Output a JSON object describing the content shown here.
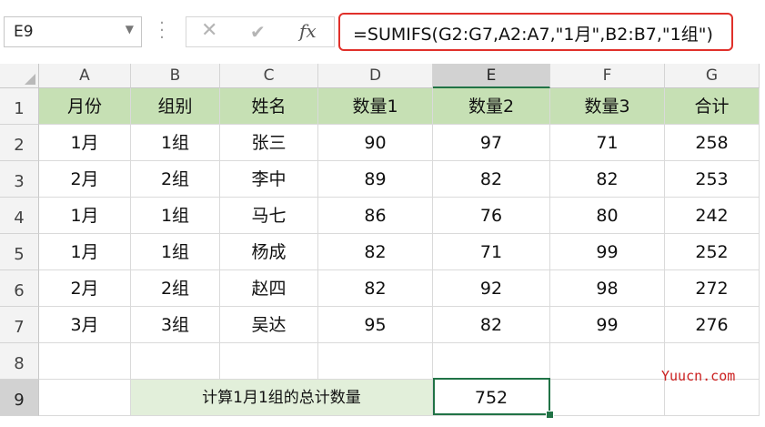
{
  "name_box": {
    "value": "E9"
  },
  "formula_bar": {
    "formula": "=SUMIFS(G2:G7,A2:A7,\"1月\",B2:B7,\"1组\")",
    "fx_label": "fx"
  },
  "columns": [
    "A",
    "B",
    "C",
    "D",
    "E",
    "F",
    "G"
  ],
  "rows": [
    "1",
    "2",
    "3",
    "4",
    "5",
    "6",
    "7",
    "8",
    "9"
  ],
  "active_column": "E",
  "active_row": "9",
  "table": {
    "headers": [
      "月份",
      "组别",
      "姓名",
      "数量1",
      "数量2",
      "数量3",
      "合计"
    ],
    "data": [
      [
        "1月",
        "1组",
        "张三",
        "90",
        "97",
        "71",
        "258"
      ],
      [
        "2月",
        "2组",
        "李中",
        "89",
        "82",
        "82",
        "253"
      ],
      [
        "1月",
        "1组",
        "马七",
        "86",
        "76",
        "80",
        "242"
      ],
      [
        "1月",
        "1组",
        "杨成",
        "82",
        "71",
        "99",
        "252"
      ],
      [
        "2月",
        "2组",
        "赵四",
        "82",
        "92",
        "98",
        "272"
      ],
      [
        "3月",
        "3组",
        "吴达",
        "95",
        "82",
        "99",
        "276"
      ]
    ]
  },
  "summary": {
    "label": "计算1月1组的总计数量",
    "result": "752"
  },
  "watermark": "Yuucn.com",
  "colors": {
    "header_fill": "#c6e0b4",
    "label_fill": "#e2efda",
    "selection": "#217346",
    "formula_highlight": "#e0302a"
  }
}
